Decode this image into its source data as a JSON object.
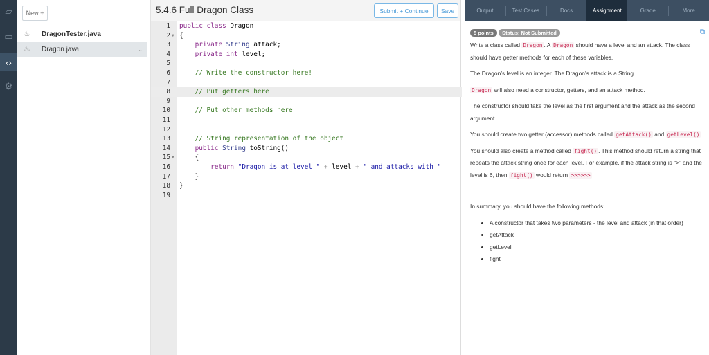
{
  "files": {
    "new_label": "New +",
    "items": [
      {
        "name": "DragonTester.java",
        "bold": true
      },
      {
        "name": "Dragon.java",
        "selected": true
      }
    ]
  },
  "editor": {
    "title": "5.4.6 Full Dragon Class",
    "submit_label": "Submit + Continue",
    "save_label": "Save",
    "active_line": 8,
    "lines": [
      [
        [
          "k",
          "public class "
        ],
        [
          "",
          "Dragon"
        ]
      ],
      [
        [
          "",
          "{"
        ]
      ],
      [
        [
          "",
          "    "
        ],
        [
          "k",
          "private "
        ],
        [
          "t",
          "String "
        ],
        [
          "",
          "attack;"
        ]
      ],
      [
        [
          "",
          "    "
        ],
        [
          "k",
          "private int "
        ],
        [
          "",
          "level;"
        ]
      ],
      [],
      [
        [
          "",
          "    "
        ],
        [
          "c",
          "// Write the constructor here!"
        ]
      ],
      [],
      [
        [
          "",
          "    "
        ],
        [
          "c",
          "// Put getters here"
        ]
      ],
      [],
      [
        [
          "",
          "    "
        ],
        [
          "c",
          "// Put other methods here"
        ]
      ],
      [],
      [],
      [
        [
          "",
          "    "
        ],
        [
          "c",
          "// String representation of the object"
        ]
      ],
      [
        [
          "",
          "    "
        ],
        [
          "k",
          "public "
        ],
        [
          "t",
          "String "
        ],
        [
          "",
          "toString()"
        ]
      ],
      [
        [
          "",
          "    {"
        ]
      ],
      [
        [
          "",
          "        "
        ],
        [
          "k",
          "return "
        ],
        [
          "s",
          "\"Dragon is at level \""
        ],
        [
          "o",
          " + "
        ],
        [
          "",
          "level"
        ],
        [
          "o",
          " + "
        ],
        [
          "s",
          "\" and attacks with \""
        ]
      ],
      [
        [
          "",
          "    }"
        ]
      ],
      [
        [
          "",
          "}"
        ]
      ],
      []
    ],
    "fold_lines": [
      2,
      15
    ]
  },
  "panel": {
    "tabs": [
      "Output",
      "Test Cases",
      "Docs",
      "Assignment",
      "Grade",
      "More"
    ],
    "active_tab": "Assignment",
    "points": "5 points",
    "status": "Status: Not Submitted",
    "p1": [
      "Write a class called ",
      "Dragon",
      ". A ",
      "Dragon",
      " should have a level and an attack. The class should have getter methods for each of these variables."
    ],
    "p2": "The Dragon’s level is an integer. The Dragon’s attack is a String.",
    "p3": [
      "Dragon",
      " will also need a constructor, getters, and an attack method."
    ],
    "p4": "The constructor should take the level as the first argument and the attack as the second argument.",
    "p5": [
      "You should create two getter (accessor) methods called ",
      "getAttack()",
      " and ",
      "getLevel()",
      "."
    ],
    "p6": [
      "You should also create a method called ",
      "fight()",
      ". This method should return a string that repeats the attack string once for each level. For example, if the attack string is “>” and the level is 6, then ",
      "fight()",
      " would return ",
      ">>>>>>"
    ],
    "summary": "In summary, you should have the following methods:",
    "methods": [
      "A constructor that takes two parameters - the level and attack (in that order)",
      "getAttack",
      "getLevel",
      "fight"
    ]
  }
}
